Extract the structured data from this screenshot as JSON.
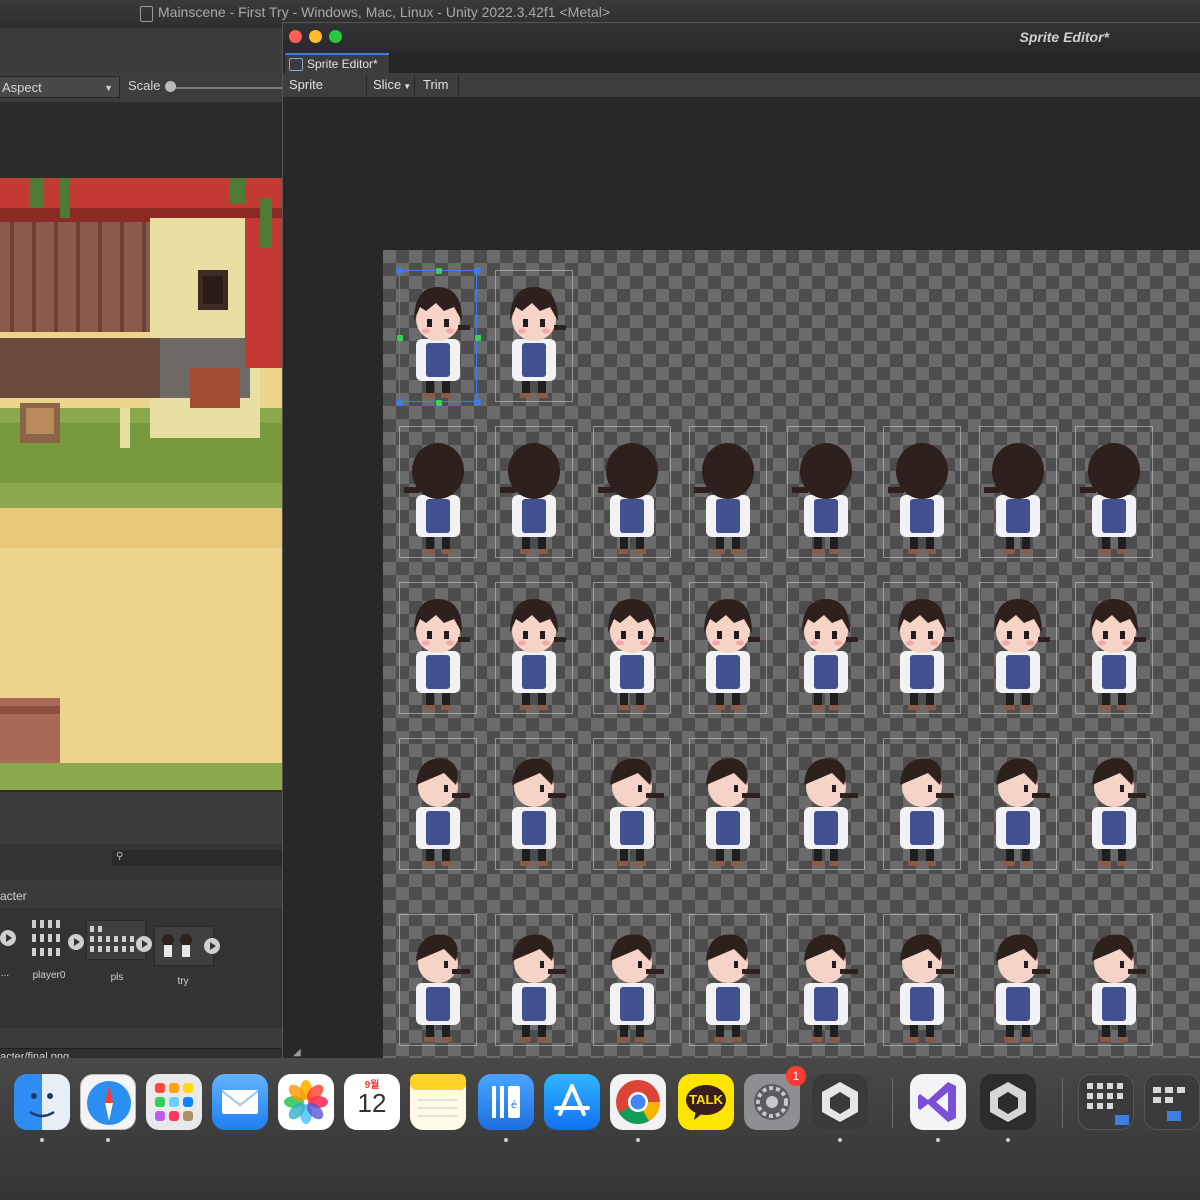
{
  "app": {
    "window_title": "Mainscene - First Try - Windows, Mac, Linux - Unity 2022.3.42f1 <Metal>"
  },
  "game_view": {
    "aspect_label": "Aspect",
    "scale_label": "Scale"
  },
  "project": {
    "breadcrumb": "acter",
    "assets": [
      {
        "label": "..."
      },
      {
        "label": "player0"
      },
      {
        "label": "pls"
      },
      {
        "label": "try"
      }
    ],
    "path": "acter/final.png"
  },
  "sprite_editor": {
    "window_title": "Sprite Editor*",
    "tab_label": "Sprite Editor*",
    "toolbar": {
      "mode_label": "Sprite Editor",
      "slice_label": "Slice",
      "trim_label": "Trim"
    }
  },
  "dock": {
    "calendar_month": "9월",
    "calendar_day": "12",
    "kakao_label": "TALK",
    "settings_badge": "1",
    "icons": [
      "finder-icon",
      "safari-icon",
      "launchpad-icon",
      "mail-icon",
      "photos-icon",
      "calendar-icon",
      "notes-icon",
      "files-icon",
      "app-store-icon",
      "chrome-icon",
      "kakaotalk-icon",
      "system-settings-icon",
      "unity-hub-icon",
      "visual-studio-icon",
      "unity-icon",
      "downloads-stack-icon",
      "screenshots-stack-icon"
    ]
  },
  "colors": {
    "sprite_hair": "#2e211d",
    "sprite_shirt": "#f2f2f4",
    "sprite_vest": "#42508f",
    "sprite_skin": "#f5d3c6",
    "selection_blue": "#3c7ef2",
    "traffic_red": "#ff5f57",
    "traffic_yellow": "#febc2e",
    "traffic_green": "#28c840"
  }
}
